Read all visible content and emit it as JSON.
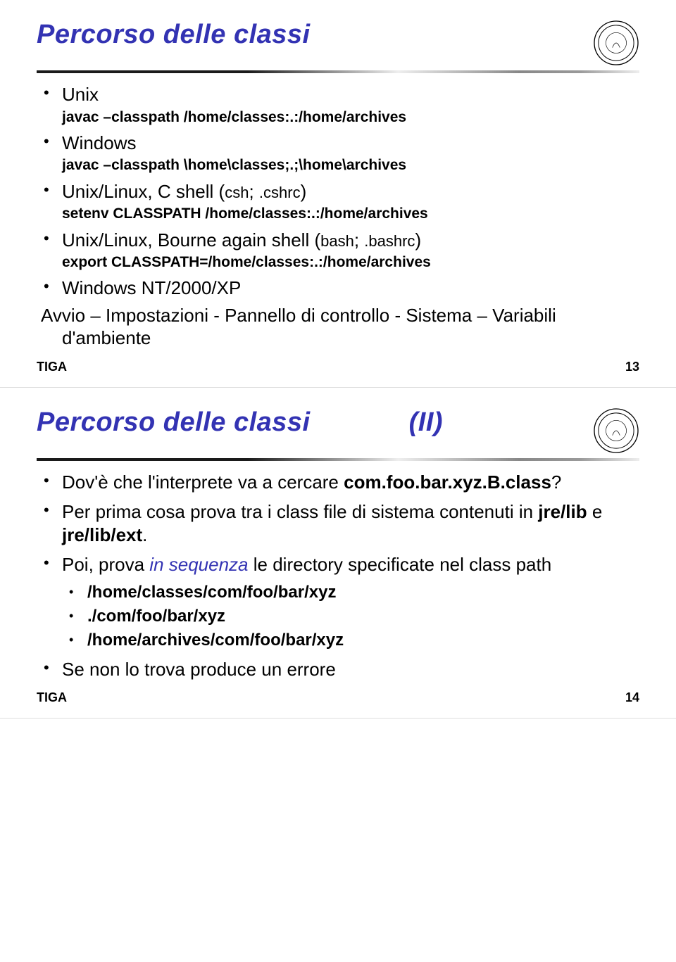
{
  "slide1": {
    "title": "Percorso delle classi",
    "seal_alt": "University seal",
    "items": [
      {
        "label": "Unix",
        "sub": "javac –classpath /home/classes:.:/home/archives"
      },
      {
        "label": "Windows",
        "sub": "javac –classpath \\home\\classes;.;\\home\\archives"
      },
      {
        "label_pre": "Unix/Linux, C shell (",
        "mono1": "csh",
        "mid": "; ",
        "mono2": ".cshrc",
        "label_post": ")",
        "sub": "setenv CLASSPATH /home/classes:.:/home/archives"
      },
      {
        "label_pre": "Unix/Linux, Bourne again shell (",
        "mono1": "bash",
        "mid": "; ",
        "mono2": ".bashrc",
        "label_post": ")",
        "sub": "export CLASSPATH=/home/classes:.:/home/archives"
      },
      {
        "label": "Windows NT/2000/XP",
        "cont1": "Avvio – Impostazioni - Pannello di controllo - Sistema – Variabili",
        "cont2": "d'ambiente"
      }
    ],
    "footer_left": "TIGA",
    "footer_right": "13"
  },
  "slide2": {
    "title": "Percorso delle classi",
    "title_suffix": "(II)",
    "seal_alt": "University seal",
    "b1_pre": "Dov'è che l'interprete va a cercare ",
    "b1_bold": "com.foo.bar.xyz.B.class",
    "b1_post": "?",
    "b2_pre": "Per prima cosa prova tra i class file di sistema contenuti in ",
    "b2_bold1": "jre/lib",
    "b2_mid": " e ",
    "b2_bold2": "jre/lib/ext",
    "b2_post": ".",
    "b3_pre": "Poi, prova ",
    "b3_italic": "in sequenza",
    "b3_post": " le directory specificate nel class path",
    "b3_sub1": "/home/classes/com/foo/bar/xyz",
    "b3_sub2": "./com/foo/bar/xyz",
    "b3_sub3": "/home/archives/com/foo/bar/xyz",
    "b4": "Se non lo trova produce un errore",
    "footer_left": "TIGA",
    "footer_right": "14"
  }
}
